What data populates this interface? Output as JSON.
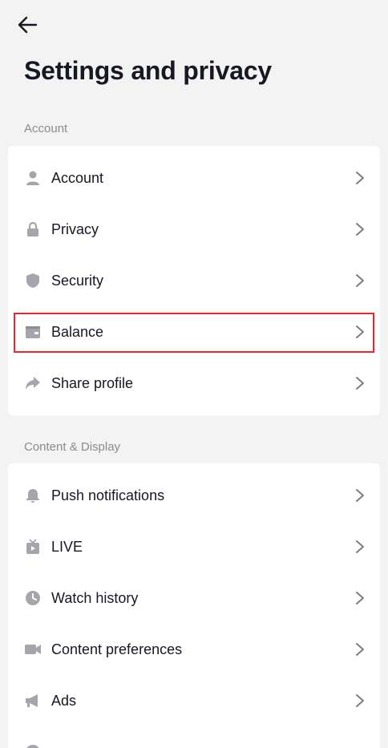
{
  "header": {
    "back_icon": "arrow-left-icon",
    "title": "Settings and privacy"
  },
  "sections": [
    {
      "label": "Account",
      "items": [
        {
          "label": "Account",
          "icon": "person-icon"
        },
        {
          "label": "Privacy",
          "icon": "lock-icon"
        },
        {
          "label": "Security",
          "icon": "shield-icon"
        },
        {
          "label": "Balance",
          "icon": "wallet-icon"
        },
        {
          "label": "Share profile",
          "icon": "share-icon"
        }
      ]
    },
    {
      "label": "Content & Display",
      "items": [
        {
          "label": "Push notifications",
          "icon": "bell-icon"
        },
        {
          "label": "LIVE",
          "icon": "tv-icon"
        },
        {
          "label": "Watch history",
          "icon": "clock-icon"
        },
        {
          "label": "Content preferences",
          "icon": "video-camera-icon"
        },
        {
          "label": "Ads",
          "icon": "megaphone-icon"
        }
      ]
    }
  ],
  "colors": {
    "background": "#f3f3f3",
    "card": "#ffffff",
    "icon": "#a5a6ab",
    "highlight": "#e4262f"
  }
}
